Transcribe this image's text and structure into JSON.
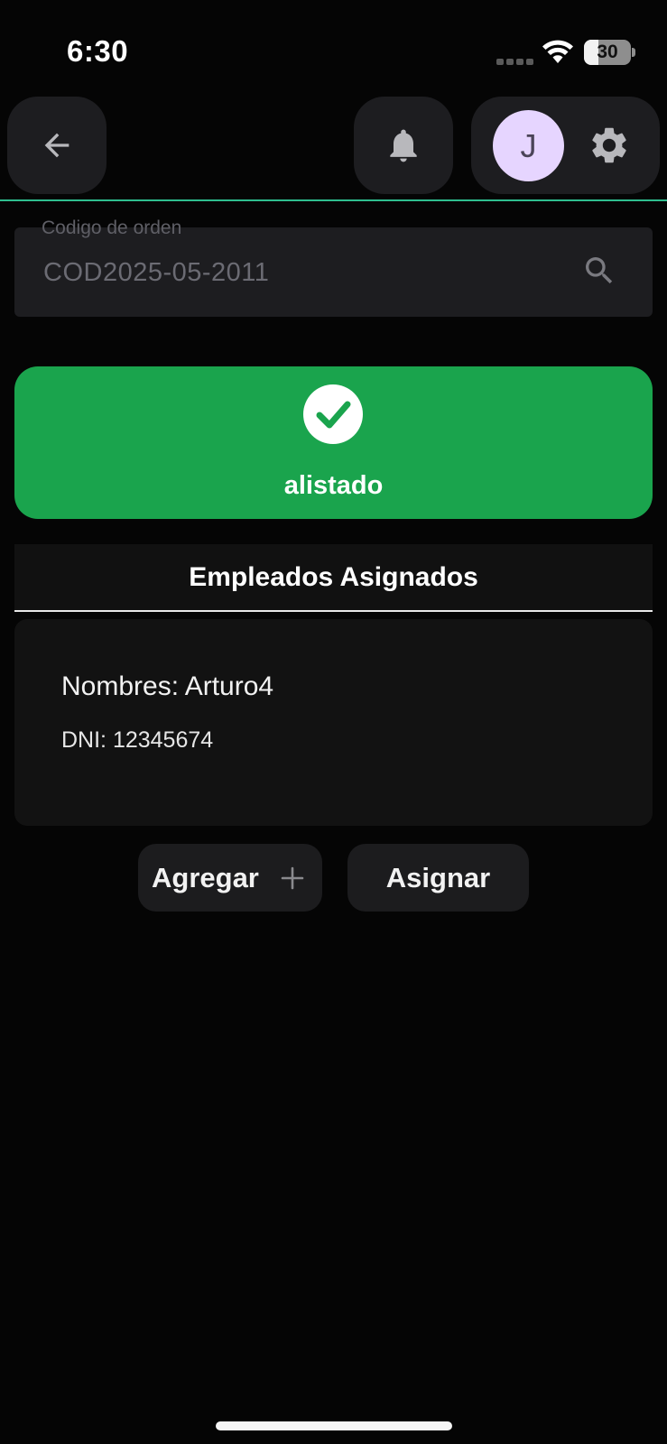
{
  "status_bar": {
    "time": "6:30",
    "battery_level": "30",
    "battery_fraction": 0.3
  },
  "header": {
    "back_icon": "arrow-left-icon",
    "notification_icon": "bell-icon",
    "avatar_initial": "J",
    "settings_icon": "gear-icon",
    "accent_line_color": "#2fbf8f"
  },
  "search": {
    "label": "Codigo de orden",
    "value": "COD2025-05-2011",
    "icon": "search-icon"
  },
  "order_status": {
    "label": "alistado",
    "icon": "check-circle-icon",
    "color": "#1aa44d"
  },
  "employees": {
    "section_title": "Empleados Asignados",
    "items": [
      {
        "name": "Nombres: Arturo4",
        "dni": "DNI: 12345674"
      }
    ]
  },
  "actions": {
    "add_label": "Agregar",
    "add_icon": "plus-icon",
    "assign_label": "Asignar"
  }
}
